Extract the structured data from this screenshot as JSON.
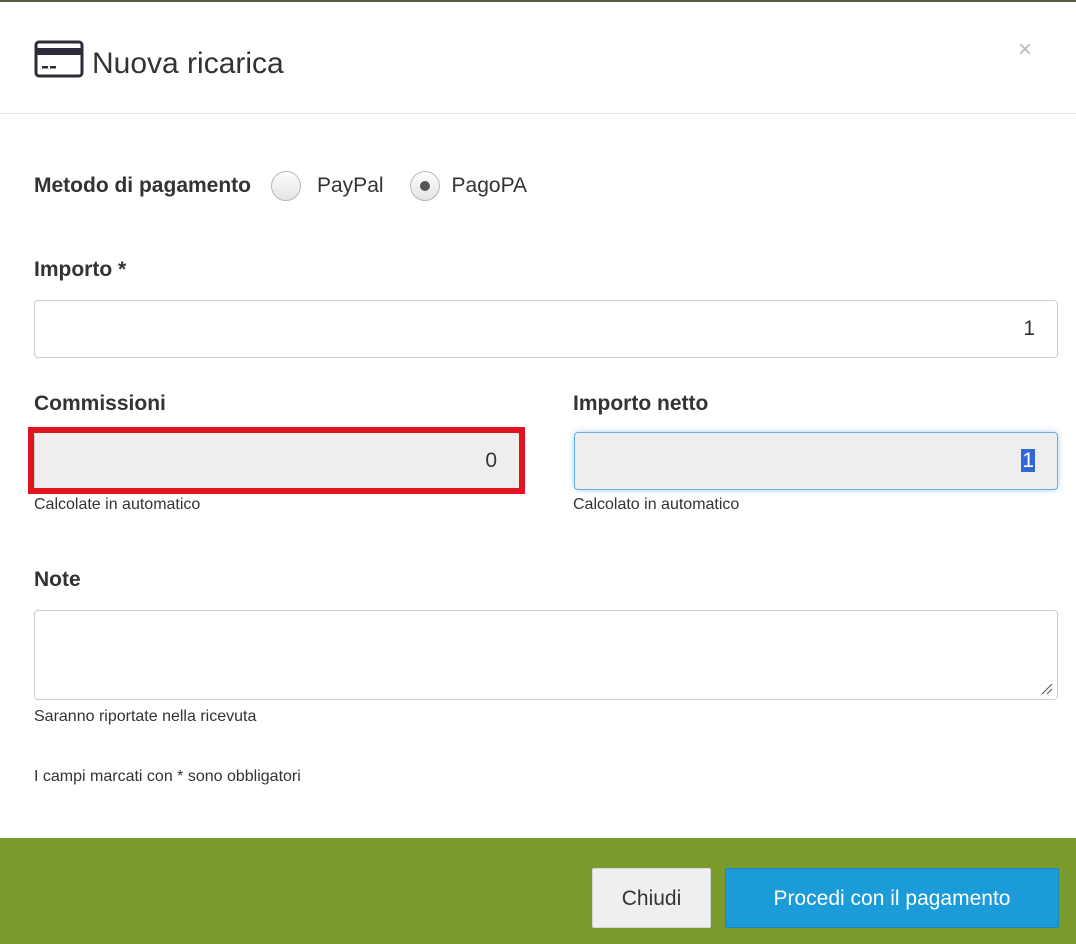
{
  "header": {
    "title": "Nuova ricarica",
    "icon": "credit-card-icon",
    "close_glyph": "×"
  },
  "payment_method": {
    "label": "Metodo di pagamento",
    "options": [
      {
        "label": "PayPal",
        "selected": false
      },
      {
        "label": "PagoPA",
        "selected": true
      }
    ]
  },
  "importo": {
    "label": "Importo *",
    "value": "1"
  },
  "commissioni": {
    "label": "Commissioni",
    "value": "0",
    "help": "Calcolate in automatico"
  },
  "importo_netto": {
    "label": "Importo netto",
    "value": "1",
    "help": "Calcolato in automatico"
  },
  "note": {
    "label": "Note",
    "value": "",
    "help": "Saranno riportate nella ricevuta"
  },
  "required_notice": "I campi marcati con * sono obbligatori",
  "footer": {
    "close_label": "Chiudi",
    "proceed_label": "Procedi con il pagamento"
  },
  "colors": {
    "footer_bg": "#7a9a2c",
    "primary_button": "#1b9bd7",
    "highlight": "#e0141e",
    "focus_border": "#66afe9"
  }
}
